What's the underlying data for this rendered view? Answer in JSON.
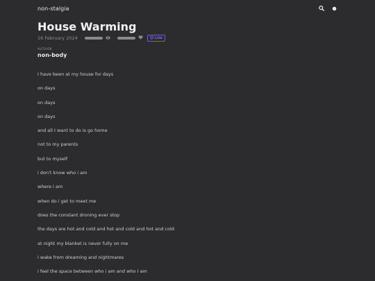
{
  "header": {
    "site_name": "non-stalgia",
    "icons": [
      "search-icon",
      "theme-toggle-icon"
    ]
  },
  "post": {
    "title": "House Warming",
    "date": "16 February 2024",
    "like_label": "Like",
    "author_label": "AUTHOR",
    "author_name": "non-body"
  },
  "poem_lines": [
    "I have been at my house for days",
    "on days",
    "on days",
    "on days",
    "and all I want to do is go home",
    "not to my parents",
    "but to myself",
    "i don't know who i am",
    "where i am",
    "when do i get to meet me",
    "does the constant droning ever stop",
    "the days are hot and cold and hot and cold and hot and cold",
    "at night my blanket is never fully on me",
    "i wake from dreaming and nightmares",
    "i feel the space between who i am and who I am"
  ],
  "colors": {
    "background": "#2c2c2e",
    "accent": "#7a5bd6"
  }
}
